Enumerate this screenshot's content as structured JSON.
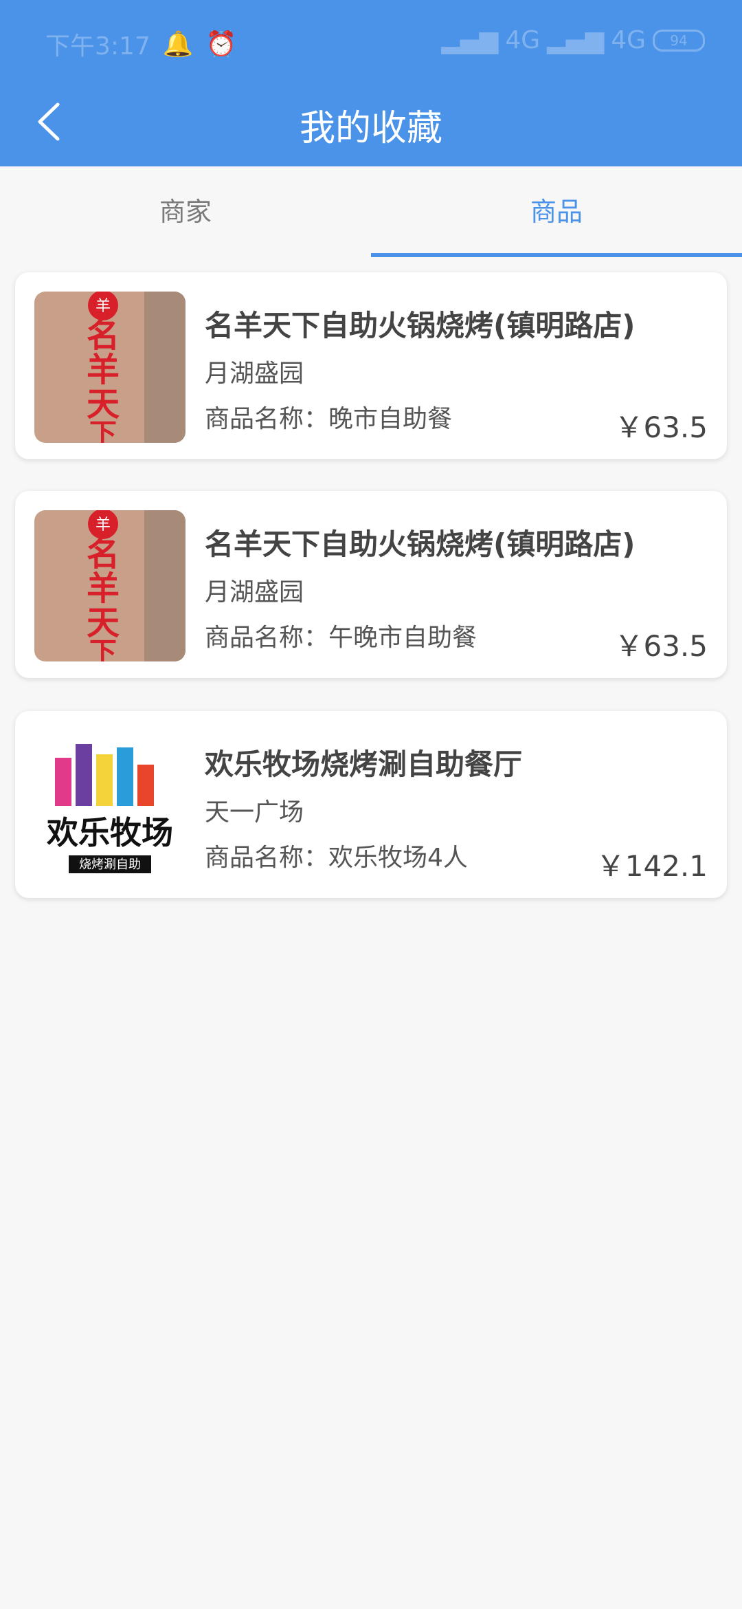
{
  "status_bar": {
    "time": "下午3:17",
    "network1": "4G",
    "network2": "4G",
    "battery": "94"
  },
  "header": {
    "title": "我的收藏"
  },
  "tabs": [
    {
      "label": "商家"
    },
    {
      "label": "商品"
    }
  ],
  "items": [
    {
      "shop": "名羊天下自助火锅烧烤(镇明路店)",
      "location": "月湖盛园",
      "product": "商品名称：晚市自助餐",
      "price": "￥63.5",
      "image_text": "名羊天下"
    },
    {
      "shop": "名羊天下自助火锅烧烤(镇明路店)",
      "location": "月湖盛园",
      "product": "商品名称：午晚市自助餐",
      "price": "￥63.5",
      "image_text": "名羊天下"
    },
    {
      "shop": "欢乐牧场烧烤涮自助餐厅",
      "location": "天一广场",
      "product": "商品名称：欢乐牧场4人",
      "price": "￥142.1",
      "image_text": "欢乐牧场"
    }
  ]
}
